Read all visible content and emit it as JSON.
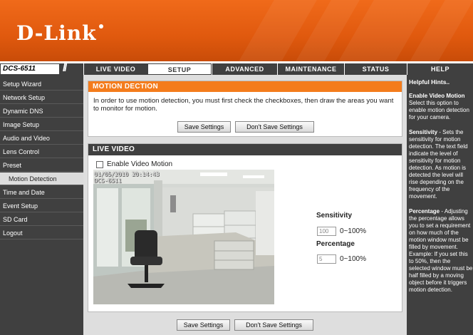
{
  "brand": {
    "logo": "D-Link"
  },
  "model": "DCS-6511",
  "nav": {
    "tabs": [
      "LIVE VIDEO",
      "SETUP",
      "ADVANCED",
      "MAINTENANCE",
      "STATUS",
      "HELP"
    ],
    "active": "SETUP"
  },
  "sidebar": {
    "items": [
      "Setup Wizard",
      "Network Setup",
      "Dynamic DNS",
      "Image Setup",
      "Audio and Video",
      "Lens Control",
      "Preset",
      "Motion Detection",
      "Time and Date",
      "Event Setup",
      "SD Card",
      "Logout"
    ],
    "active": "Motion Detection"
  },
  "motion": {
    "title": "MOTION DECTION",
    "description": "In order to use motion detection, you must first check the checkboxes, then draw the areas you want to monitor for motion.",
    "save_label": "Save Settings",
    "dont_save_label": "Don't Save Settings"
  },
  "live": {
    "title": "LIVE VIDEO",
    "enable_label": "Enable Video Motion",
    "enable_checked": false,
    "timestamp": "01/05/2010 20:14:43",
    "camera_name": "DCS-6511"
  },
  "sensitivity": {
    "label": "Sensitivity",
    "value": "100",
    "range": "0~100%"
  },
  "percentage": {
    "label": "Percentage",
    "value": "5",
    "range": "0~100%"
  },
  "bottom": {
    "save_label": "Save Settings",
    "dont_save_label": "Don't Save Settings"
  },
  "hints": {
    "title": "Helpful Hints..",
    "enable_title": "Enable Video Motion",
    "enable_text": "Select this option to enable motion detection for your camera.",
    "sensitivity_title": "Sensitivity",
    "sensitivity_text": "Sets the sensitivity for motion detection. The text field indicate the level of sensitivity for motion detection. As motion is detected the level will rise depending on the frequency of the movement.",
    "percentage_title": "Percentage",
    "percentage_text": "Adjusting the percentage allows you to set a requirement on how much of the motion window must be filled by movement. Example: If you set this to 50%, then the selected window must be half filled by a moving object before it triggers motion detection."
  },
  "colors": {
    "brand_orange": "#e8620f",
    "nav_dark": "#404040",
    "panel_head_orange": "#f47c1c"
  }
}
